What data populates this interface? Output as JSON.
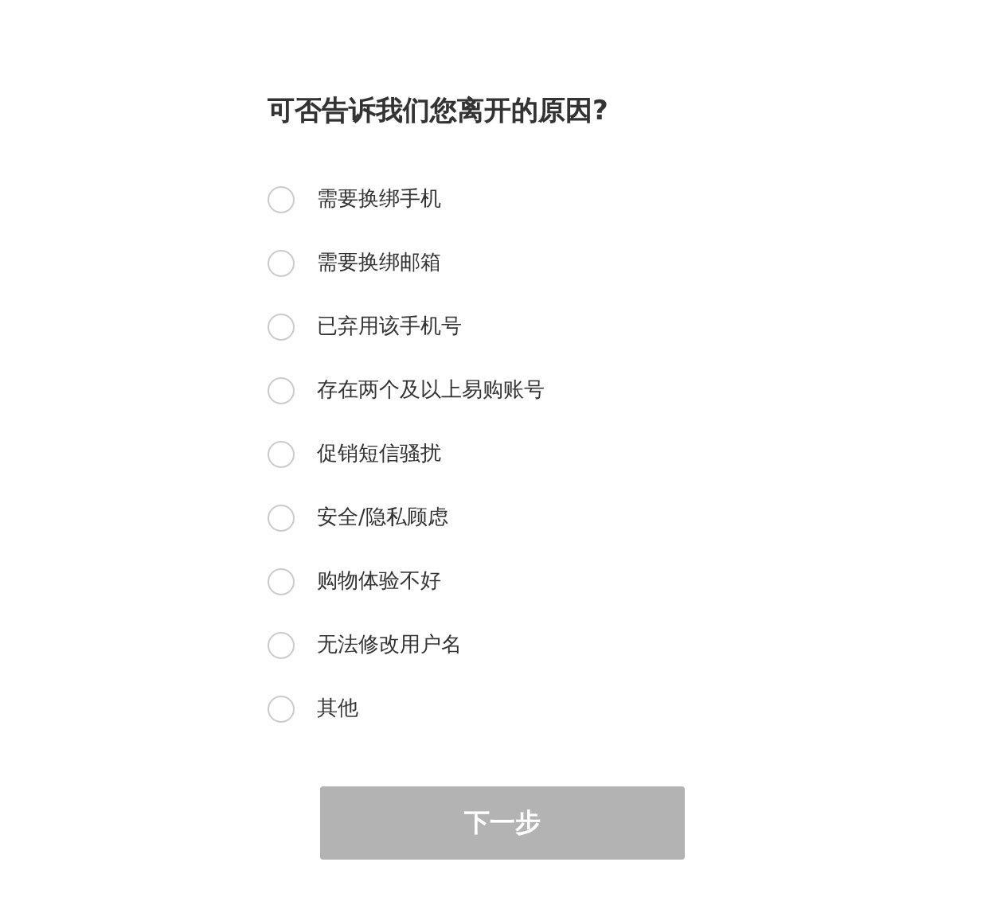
{
  "title": "可否告诉我们您离开的原因?",
  "options": [
    {
      "label": "需要换绑手机",
      "selected": false
    },
    {
      "label": "需要换绑邮箱",
      "selected": false
    },
    {
      "label": "已弃用该手机号",
      "selected": false
    },
    {
      "label": "存在两个及以上易购账号",
      "selected": false
    },
    {
      "label": "促销短信骚扰",
      "selected": false
    },
    {
      "label": "安全/隐私顾虑",
      "selected": false
    },
    {
      "label": "购物体验不好",
      "selected": false
    },
    {
      "label": "无法修改用户名",
      "selected": false
    },
    {
      "label": "其他",
      "selected": false
    }
  ],
  "next_button": {
    "label": "下一步",
    "disabled": true
  }
}
